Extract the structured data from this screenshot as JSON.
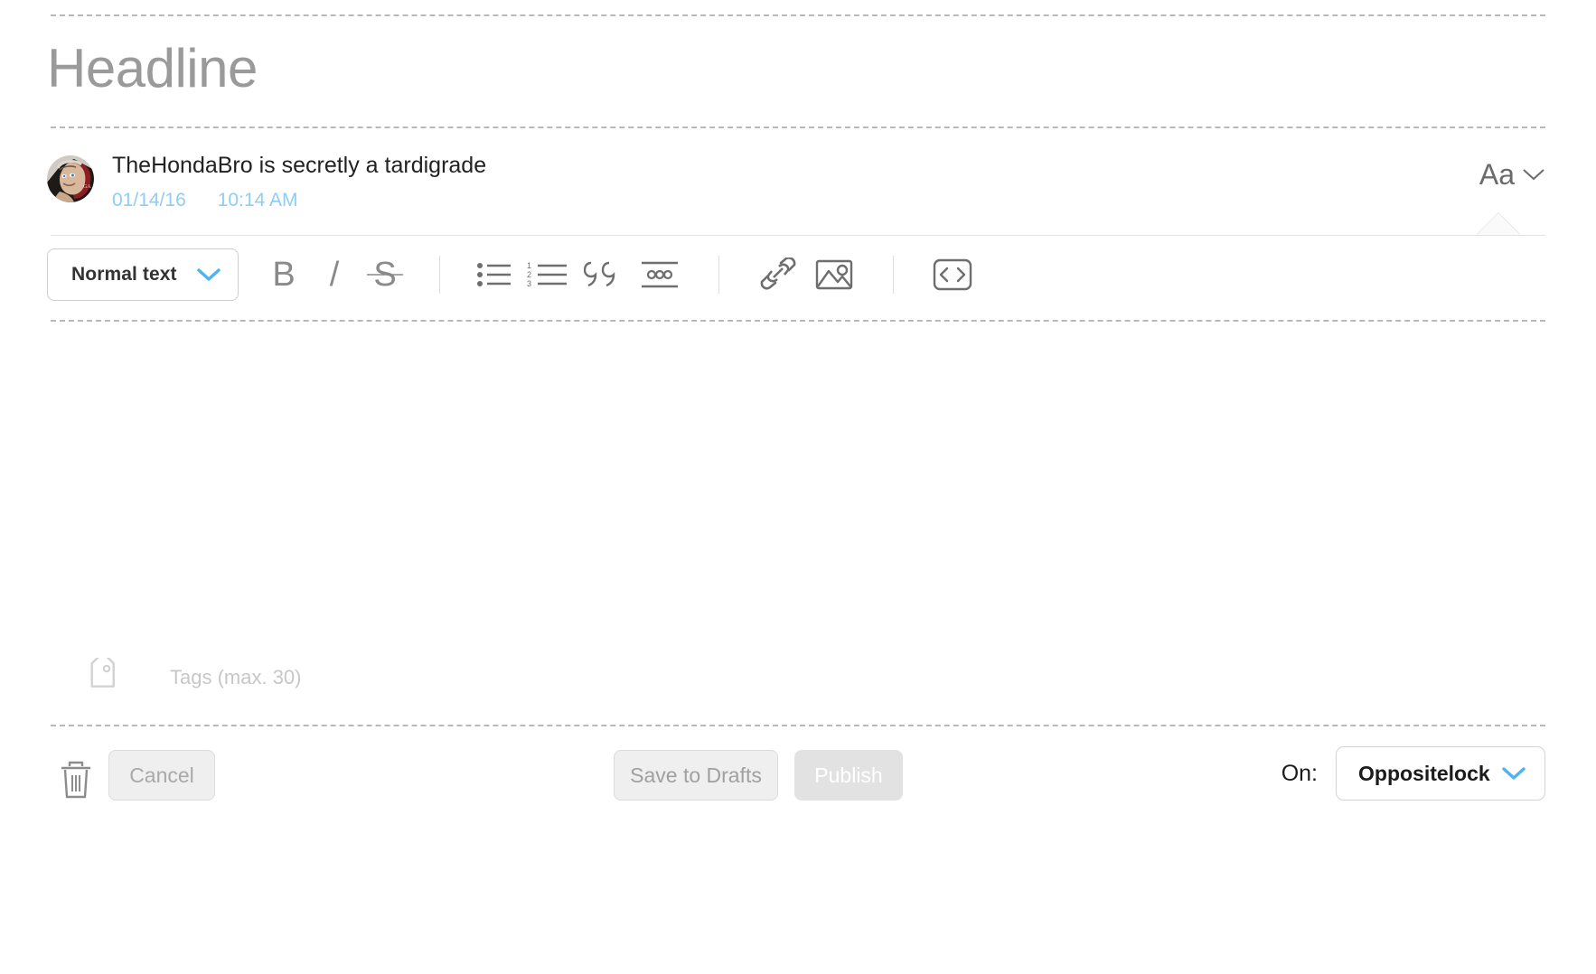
{
  "editor": {
    "headline_placeholder": "Headline",
    "body_value": ""
  },
  "author": {
    "byline": "TheHondaBro is secretly a tardigrade",
    "date": "01/14/16",
    "time": "10:14 AM",
    "avatar_name": "avatar"
  },
  "font_control": {
    "label": "Aa",
    "chevron": "chevron-down-icon"
  },
  "toolbar": {
    "style_select": {
      "value": "Normal text",
      "chevron": "chevron-down-icon"
    },
    "buttons": [
      {
        "name": "bold-icon",
        "glyph": "B"
      },
      {
        "name": "italic-icon",
        "glyph": "/"
      },
      {
        "name": "strikethrough-icon",
        "glyph": "S"
      },
      {
        "name": "bulleted-list-icon",
        "glyph": ""
      },
      {
        "name": "numbered-list-icon",
        "glyph": ""
      },
      {
        "name": "blockquote-icon",
        "glyph": "99"
      },
      {
        "name": "divider-icon",
        "glyph": "ooo"
      },
      {
        "name": "link-icon",
        "glyph": ""
      },
      {
        "name": "image-icon",
        "glyph": ""
      },
      {
        "name": "code-icon",
        "glyph": "<>"
      }
    ],
    "numbered_list_digits": [
      "1",
      "2",
      "3"
    ]
  },
  "tags": {
    "icon": "tag-icon",
    "placeholder": "Tags (max. 30)",
    "value": ""
  },
  "footer": {
    "delete_icon": "trash-icon",
    "cancel_label": "Cancel",
    "save_drafts_label": "Save to Drafts",
    "publish_label": "Publish",
    "on_label": "On:",
    "blog_value": "Oppositelock",
    "blog_chevron": "chevron-down-icon"
  },
  "colors": {
    "accent_blue": "#4fb3f0",
    "meta_blue": "#8ecdf5",
    "placeholder_gray": "#9a9a9a",
    "icon_gray": "#6e6e6e",
    "button_gray": "#efefef",
    "publish_gray": "#e2e2e2"
  }
}
